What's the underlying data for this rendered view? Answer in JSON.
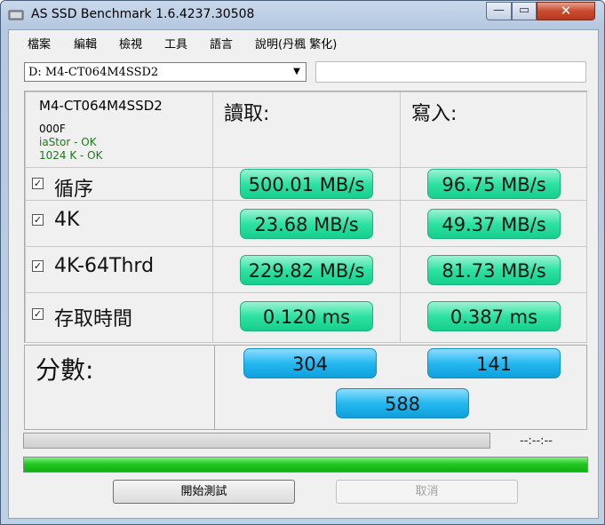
{
  "window": {
    "title": "AS SSD Benchmark 1.6.4237.30508"
  },
  "caption_buttons": {
    "minimize": "—",
    "maximize": "▭",
    "close": "✕"
  },
  "menu": [
    "檔案",
    "編輯",
    "檢視",
    "工具",
    "語言",
    "說明(丹楓 繁化)"
  ],
  "drive_select": {
    "value": "D: M4-CT064M4SSD2",
    "arrow": "▼"
  },
  "drive_info": {
    "model": "M4-CT064M4SSD2",
    "firmware": "000F",
    "driver": "iaStor - OK",
    "alignment": "1024 K - OK"
  },
  "headers": {
    "read": "讀取:",
    "write": "寫入:"
  },
  "check_mark": "✓",
  "rows": [
    {
      "label": "循序",
      "checked": true,
      "read": "500.01 MB/s",
      "write": "96.75 MB/s"
    },
    {
      "label": "4K",
      "checked": true,
      "read": "23.68 MB/s",
      "write": "49.37 MB/s"
    },
    {
      "label": "4K-64Thrd",
      "checked": true,
      "read": "229.82 MB/s",
      "write": "81.73 MB/s"
    },
    {
      "label": "存取時間",
      "checked": true,
      "read": "0.120 ms",
      "write": "0.387 ms"
    }
  ],
  "score": {
    "label": "分數:",
    "read": "304",
    "write": "141",
    "total": "588"
  },
  "progress": {
    "time": "--:--:--",
    "top_fill": 0,
    "bottom_fill": 1.0
  },
  "buttons": {
    "start": "開始測試",
    "cancel": "取消"
  },
  "colors": {
    "result_green": "#2ee2a2",
    "score_blue": "#25b8ef",
    "progress_green": "#23c823"
  }
}
